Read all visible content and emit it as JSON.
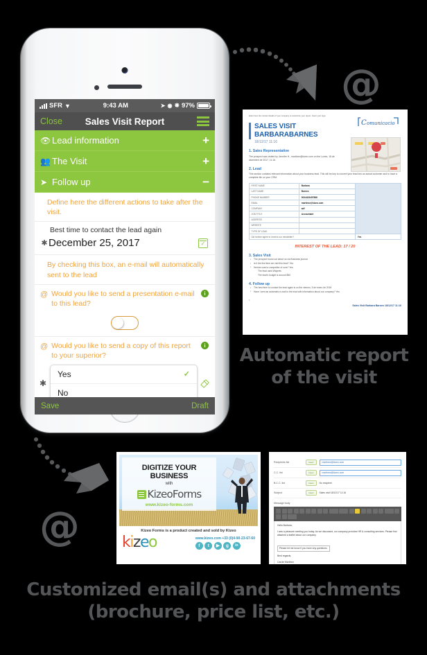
{
  "phone": {
    "status_bar": {
      "carrier": "SFR",
      "time": "9:43 AM",
      "battery": "97%"
    },
    "nav": {
      "close": "Close",
      "title": "Sales Visit Report",
      "menu_icon": "hamburger-menu-icon"
    },
    "sections": [
      {
        "icon": "eye-icon",
        "label": "Lead information",
        "toggle": "+"
      },
      {
        "icon": "people-icon",
        "label": "The Visit",
        "toggle": "+"
      },
      {
        "icon": "share-arrow-icon",
        "label": "Follow up",
        "toggle": "−"
      }
    ],
    "form": {
      "help_1": "Define here the different actions to take after the visit.",
      "field_label_1": "Best time to contact the lead again",
      "date_value": "December 25, 2017",
      "calendar_icon": "calendar-icon",
      "help_2": "By checking this box, an e-mail will automatically sent to the lead",
      "question_1": "Would you like to send a presentation e-mail to this lead?",
      "toggle_state": "off",
      "question_2": "Would you like to send a copy of this report to your superior?",
      "dropdown_options": [
        {
          "label": "Yes",
          "selected": true
        },
        {
          "label": "No",
          "selected": false
        }
      ],
      "eraser_icon": "eraser-icon",
      "info_icon": "info-icon",
      "at_icon": "at-icon",
      "required_icon": "required-asterisk-icon"
    },
    "savebar": {
      "save": "Save",
      "draft": "Draft"
    }
  },
  "report": {
    "top_note": "Enter here the contact details of your company to customize your report. Insert your logo.",
    "logo": "Comunicacio",
    "title_line1": "SALES VISIT",
    "title_line2": "BARBARABARNES",
    "date": "18/12/17 11:16",
    "h1": "1.  Sales Representative",
    "p1": "The prospect was visited by Jennifer H., martinez@kizeo.com on the Lunes, 18 de diciembre de 2017, 11:16.",
    "h2": "2.  Lead",
    "p2": "This section contains relevant information about your business lead. This will be key to convert your lead into an actual customer and to have a complete file on your CRM.",
    "table": [
      {
        "key": "FIRST NAME",
        "value": "Barbara"
      },
      {
        "key": "LAST NAME",
        "value": "Barnes"
      },
      {
        "key": "PHONE NUMBER",
        "value": "0034423457888"
      },
      {
        "key": "EMAIL",
        "value": "martinez@kizeo.com"
      },
      {
        "key": "COMPANY",
        "value": "adf"
      },
      {
        "key": "JOB TITLE",
        "value": "Accountant"
      },
      {
        "key": "ADDRESS",
        "value": ""
      },
      {
        "key": "WEBSITE",
        "value": ""
      },
      {
        "key": "TYPE OF LEAD",
        "value": ""
      }
    ],
    "newsletter_q": "Did he/she agree to receive our newsletter?",
    "newsletter_a": "Yes",
    "interest": "INTEREST OF THE LEAD: 17 / 20",
    "h3": "3.  Sales Visit",
    "visit_items": [
      "The prospect found out about us via Business journal",
      "Is it the first time we visit this lead? Yes",
      "He/she used a competitor of ours? Yes"
    ],
    "visit_subitems": [
      "The lead used Wapreis",
      "The lead's budget is around $50"
    ],
    "h4": "4.  Follow up",
    "follow_items": [
      "The best time to contact the lead again is on the viernes, 5 de enero de 2018",
      "Have I sent an automatic e-mail to the lead with information about our company? Yes"
    ],
    "page_num": "1",
    "footer": "Sales Visit Barbara Barnes 18/12/17 11:16"
  },
  "captions": {
    "report": "Automatic report\nof the visit",
    "report_line1": "Automatic report",
    "report_line2": "of the visit",
    "email_line1": "Customized email(s) and attachments",
    "email_line2": "(brochure, price list, etc.)"
  },
  "brochure": {
    "title_line1": "DIGITIZE YOUR",
    "title_line2": "BUSINESS",
    "with": "with",
    "product": "KizeoForms",
    "url": "www.kizeo-forms.com",
    "credit": "Kizeo Forms is a product created and sold by Kizeo",
    "logo": "kizeo",
    "company_web": "www.kizeo.com  +33 (0)4-90-23-67-60",
    "socials": [
      "f",
      "t",
      "y",
      "g",
      "in"
    ]
  },
  "email": {
    "rows": [
      {
        "label": "Recipients list",
        "button": "Insert",
        "value": "martinez@kizeo.com",
        "highlighted": true
      },
      {
        "label": "C.C. list",
        "button": "Insert",
        "value": "martinez@kizeo.com",
        "highlighted": true
      },
      {
        "label": "B.C.C. list",
        "button": "Insert",
        "value": "No recipient",
        "highlighted": false
      },
      {
        "label": "Subject",
        "button": "Insert",
        "value": "Sales visit 18/12/17 11:16",
        "highlighted": false
      }
    ],
    "message_body_label": "Message body",
    "body": [
      "Hello Barbara,",
      "I was a pleasure meeting you today. As we discussed, our company provides HR & consulting services. Please find attached a leaflet about our company.",
      "Please let me know if you have any questions.",
      "Best regards,",
      "Carole Martinez"
    ]
  },
  "colors": {
    "green": "#8dc63f",
    "orange": "#f0a33c",
    "dark_gray": "#555555",
    "report_blue": "#2f74bc",
    "interest_red": "#e8552e"
  }
}
